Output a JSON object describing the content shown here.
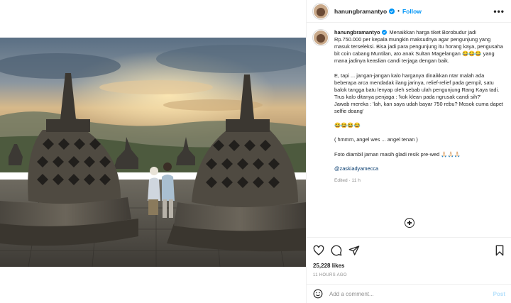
{
  "header": {
    "username": "hanungbramantyo",
    "separator": "•",
    "follow_label": "Follow",
    "more": "•••"
  },
  "caption": {
    "username": "hanungbramantyo",
    "para1": "Menaikkan harga tiket Borobudur jadi Rp.750.000 per kepala mungkin maksudnya agar pengunjung yang masuk terseleksi. Bisa jadi para pengunjung itu horang kaya, pengusaha bit coin cabang Muntilan, ato anak Sultan Magelangan 😂😂😂 yang mana jadinya keaslian candi terjaga dengan baik.",
    "para2": "E, tapi ... jangan-jangan kalo harganya dinaikkan ntar malah ada beberapa arca mendadak ilang jarinya, relief-relief pada gempil, satu balok tangga batu lenyap oleh sebab ulah pengunjung Rang Kaya tadi. Trus kalo ditanya penjaga : 'kok klean pada ngrusak candi sih?'\nJawab mereka : 'lah, kan saya udah bayar 750 rebu? Mosok cuma dapet selfie doang'",
    "para3": "😂😂😂😂",
    "para4": "( hmmm, angel wes ... angel tenan )",
    "para5": "Foto diambil jaman masih gladi resik pre-wed 🙏🏻🙏🏻🙏🏻",
    "mention": "@zaskiadyamecca",
    "meta": "Edited · 11 h"
  },
  "icons": {
    "verified": "verified-badge-icon",
    "like": "heart-icon",
    "comment": "comment-bubble-icon",
    "share": "paper-plane-icon",
    "save": "bookmark-icon",
    "load_more": "plus-circle-icon",
    "emoji": "smiley-icon"
  },
  "stats": {
    "likes": "25,228 likes",
    "time_ago": "11 HOURS AGO"
  },
  "comment": {
    "placeholder": "Add a comment...",
    "post_label": "Post"
  },
  "colors": {
    "accent": "#0095f6",
    "post_disabled": "#b2dffc",
    "mention": "#00376b",
    "muted": "#8e8e8e"
  }
}
